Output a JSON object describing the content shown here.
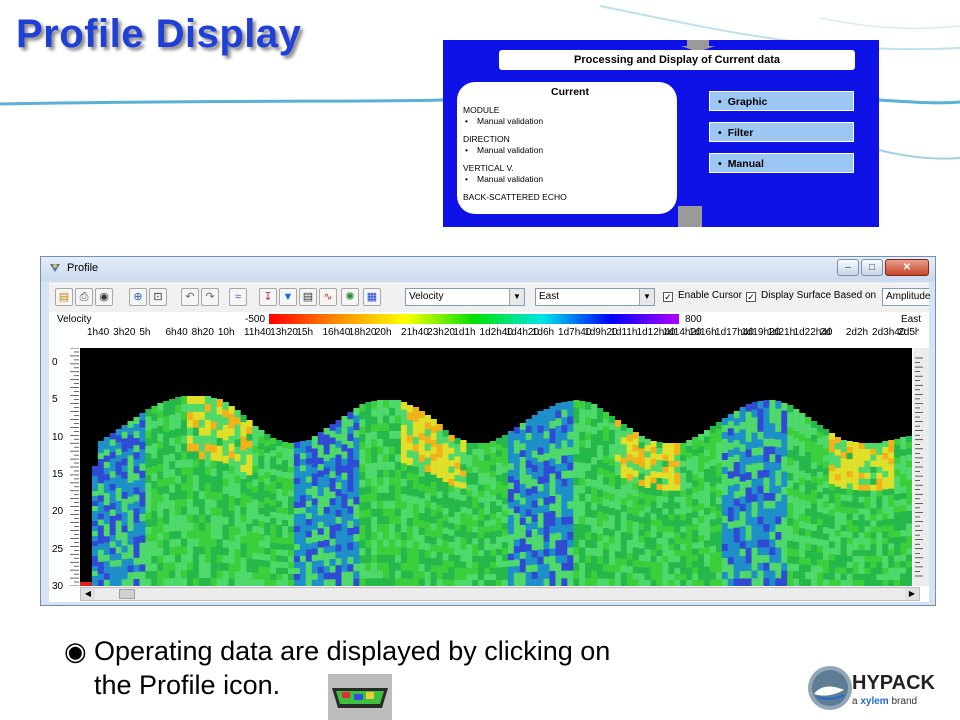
{
  "slide": {
    "title": "Profile Display",
    "caption_line1": "Operating data are displayed by clicking on",
    "caption_line2": "the Profile icon.",
    "logo_brand": "HYPACK",
    "logo_sub_pre": "a",
    "logo_sub_brand": "xylem",
    "logo_sub_post": "brand"
  },
  "flow_diagram": {
    "header": "Processing and Display of Current data",
    "current": {
      "title": "Current",
      "sections": [
        {
          "heading": "MODULE",
          "items": [
            "Manual validation"
          ]
        },
        {
          "heading": "DIRECTION",
          "items": [
            "Manual validation"
          ]
        },
        {
          "heading": "VERTICAL V.",
          "items": [
            "Manual validation"
          ]
        },
        {
          "heading": "BACK-SCATTERED ECHO",
          "items": []
        }
      ]
    },
    "buttons": [
      "Graphic",
      "Filter",
      "Manual"
    ]
  },
  "window": {
    "title": "Profile",
    "toolbar": {
      "parameter_select": "Velocity",
      "component_select": "East",
      "enable_cursor_label": "Enable Cursor",
      "enable_cursor_checked": true,
      "display_surface_label": "Display Surface Based on",
      "display_surface_checked": true,
      "surface_select": "Amplitude"
    },
    "plot": {
      "left_label": "Velocity",
      "right_label": "East",
      "colorbar_min": "-500",
      "colorbar_max": "800",
      "time_ticks": [
        "1h40",
        "3h20",
        "5h",
        "6h40",
        "8h20",
        "10h",
        "11h40",
        "13h20",
        "15h",
        "16h40",
        "18h20",
        "20h",
        "21h40",
        "23h20",
        "1d1h",
        "1d2h40",
        "1d4h20",
        "1d6h",
        "1d7h40",
        "1d9h20",
        "1d11h",
        "1d12h40",
        "1d14h20",
        "1d16h",
        "1d17h40",
        "1d19h20",
        "1d21h",
        "1d22h40",
        "2d",
        "2d2h",
        "2d3h40",
        "2d5h20"
      ],
      "depth_ticks": [
        "0",
        "5",
        "10",
        "15",
        "20",
        "25",
        "30"
      ]
    },
    "colors": {
      "background": "#000000",
      "colorbar": [
        "#ff0000",
        "#ff8c00",
        "#ffff00",
        "#00e000",
        "#00e6e6",
        "#0000ff",
        "#b000ff"
      ]
    }
  },
  "chart_data": {
    "type": "heatmap",
    "title": "",
    "xlabel": "",
    "ylabel": "",
    "series_label": "Velocity",
    "component": "East",
    "color_scale": {
      "min": -500,
      "max": 800
    },
    "ylim": [
      0,
      30
    ],
    "x_ticks": [
      "1h40",
      "3h20",
      "5h",
      "6h40",
      "8h20",
      "10h",
      "11h40",
      "13h20",
      "15h",
      "16h40",
      "18h20",
      "20h",
      "21h40",
      "23h20",
      "1d1h",
      "1d2h40",
      "1d4h20",
      "1d6h",
      "1d7h40",
      "1d9h20",
      "1d11h",
      "1d12h40",
      "1d14h20",
      "1d16h",
      "1d17h40",
      "1d19h20",
      "1d21h",
      "1d22h40",
      "2d",
      "2d2h",
      "2d3h40",
      "2d5h20"
    ],
    "surface_depth_profile": [
      30,
      12,
      10.5,
      9,
      7.5,
      6.5,
      6,
      6,
      6.5,
      8,
      10,
      11.5,
      12,
      11.5,
      10,
      8.5,
      7,
      6.5,
      6.5,
      7.5,
      9,
      11,
      12,
      12,
      11,
      9.5,
      8,
      7,
      6.5,
      7,
      8.5,
      10,
      11.5,
      12,
      12,
      11,
      9.5,
      8,
      6.8,
      6.5,
      7,
      8.5,
      10,
      11.5,
      12,
      12,
      11.5,
      11
    ]
  }
}
